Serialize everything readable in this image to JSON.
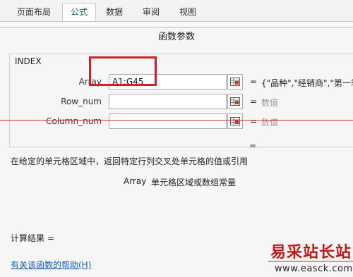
{
  "ribbon": {
    "tabs": [
      {
        "label": "页面布局",
        "active": false
      },
      {
        "label": "公式",
        "active": true
      },
      {
        "label": "数据",
        "active": false
      },
      {
        "label": "审阅",
        "active": false
      },
      {
        "label": "视图",
        "active": false
      }
    ]
  },
  "dialog": {
    "title": "函数参数",
    "function_name": "INDEX",
    "args": [
      {
        "label": "Array",
        "value": "A1:G45",
        "result": "{\"品种\",\"经销商\",\"第一季度"
      },
      {
        "label": "Row_num",
        "value": "",
        "result": "数值"
      },
      {
        "label": "Column_num",
        "value": "",
        "result": "数值"
      }
    ],
    "equals": "=",
    "formula_result_eq": "=",
    "description": "在给定的单元格区域中，返回特定行列交叉处单元格的值或引用",
    "arg_help": {
      "name": "Array",
      "text": "单元格区域或数组常量"
    },
    "calc_result_label": "计算结果 =",
    "help_link": "有关该函数的帮助(H)"
  },
  "watermark": {
    "cn": "易采站长站",
    "en": "www.easck.com"
  },
  "colors": {
    "highlight": "#d0202a",
    "link": "#1a5fb4",
    "ribbon_active": "#1e6b39"
  }
}
